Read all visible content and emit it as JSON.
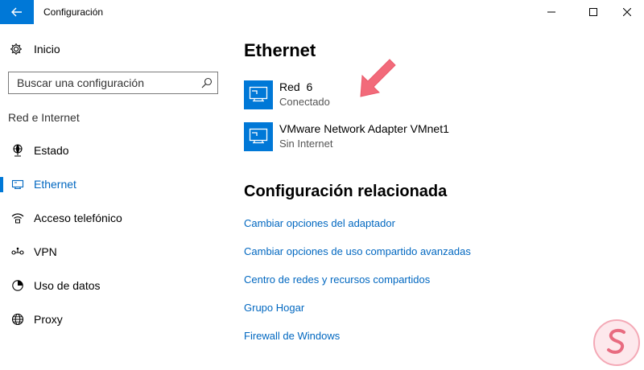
{
  "window": {
    "title": "Configuración",
    "back_icon": "arrow-left-icon",
    "controls": [
      "minimize-icon",
      "maximize-icon",
      "close-icon"
    ]
  },
  "sidebar": {
    "home": {
      "label": "Inicio",
      "icon": "gear-icon"
    },
    "search": {
      "placeholder": "Buscar una configuración",
      "value": "",
      "icon": "search-icon"
    },
    "section_label": "Red e Internet",
    "items": [
      {
        "label": "Estado",
        "icon": "globe-network-icon",
        "selected": false
      },
      {
        "label": "Ethernet",
        "icon": "ethernet-icon",
        "selected": true
      },
      {
        "label": "Acceso telefónico",
        "icon": "dial-up-icon",
        "selected": false
      },
      {
        "label": "VPN",
        "icon": "vpn-icon",
        "selected": false
      },
      {
        "label": "Uso de datos",
        "icon": "data-usage-icon",
        "selected": false
      },
      {
        "label": "Proxy",
        "icon": "globe-icon",
        "selected": false
      }
    ]
  },
  "main": {
    "title": "Ethernet",
    "adapters": [
      {
        "name": "Red  6",
        "status": "Conectado",
        "icon": "monitor-network-icon"
      },
      {
        "name": "VMware Network Adapter VMnet1",
        "status": "Sin Internet",
        "icon": "monitor-network-icon"
      }
    ],
    "related_title": "Configuración relacionada",
    "related_links": [
      "Cambiar opciones del adaptador",
      "Cambiar opciones de uso compartido avanzadas",
      "Centro de redes y recursos compartidos",
      "Grupo Hogar",
      "Firewall de Windows"
    ]
  },
  "colors": {
    "accent": "#0078d7",
    "link": "#0067c0",
    "annotation_arrow": "#f26a7a"
  }
}
